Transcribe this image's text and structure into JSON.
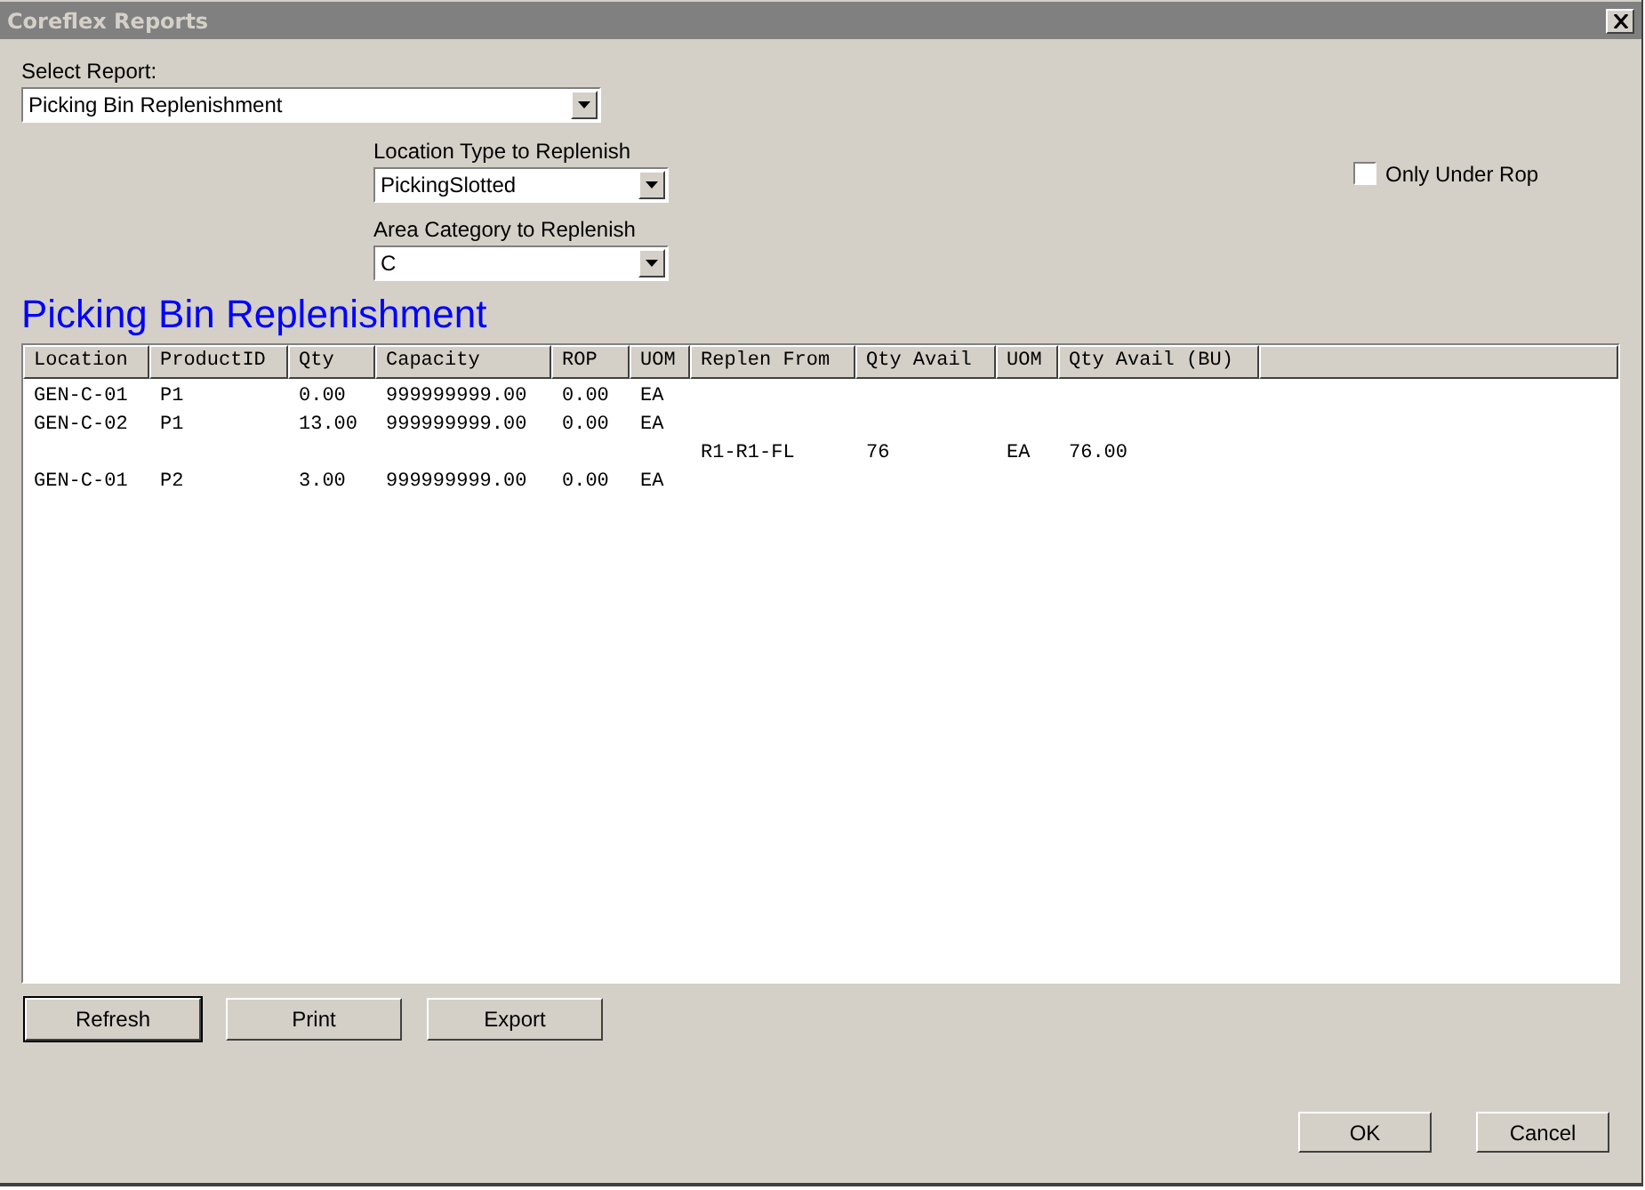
{
  "window": {
    "title": "Coreflex Reports"
  },
  "select_report": {
    "label": "Select Report:",
    "value": "Picking Bin Replenishment"
  },
  "location_type": {
    "label": "Location Type to Replenish",
    "value": "PickingSlotted"
  },
  "area_category": {
    "label": "Area Category to Replenish",
    "value": "C"
  },
  "only_under_rop": {
    "label": "Only Under Rop",
    "checked": false
  },
  "report_title": "Picking Bin Replenishment",
  "table": {
    "columns": [
      "Location",
      "ProductID",
      "Qty",
      "Capacity",
      "ROP",
      "UOM",
      "Replen From",
      "Qty Avail",
      "UOM",
      "Qty Avail (BU)"
    ],
    "rows": [
      {
        "location": "GEN-C-01",
        "product_id": "P1",
        "qty": "0.00",
        "capacity": "999999999.00",
        "rop": "0.00",
        "uom": "EA"
      },
      {
        "location": "GEN-C-02",
        "product_id": "P1",
        "qty": "13.00",
        "capacity": "999999999.00",
        "rop": "0.00",
        "uom": "EA"
      },
      {
        "replen_from": "R1-R1-FL",
        "qty_avail": "76",
        "avail_uom": "EA",
        "qty_avail_bu": "76.00"
      },
      {
        "location": "GEN-C-01",
        "product_id": "P2",
        "qty": "3.00",
        "capacity": "999999999.00",
        "rop": "0.00",
        "uom": "EA"
      }
    ]
  },
  "actions": [
    {
      "label": "Refresh",
      "default": true
    },
    {
      "label": "Print",
      "default": false
    },
    {
      "label": "Export",
      "default": false
    }
  ],
  "dialog_buttons": [
    "OK",
    "Cancel"
  ]
}
